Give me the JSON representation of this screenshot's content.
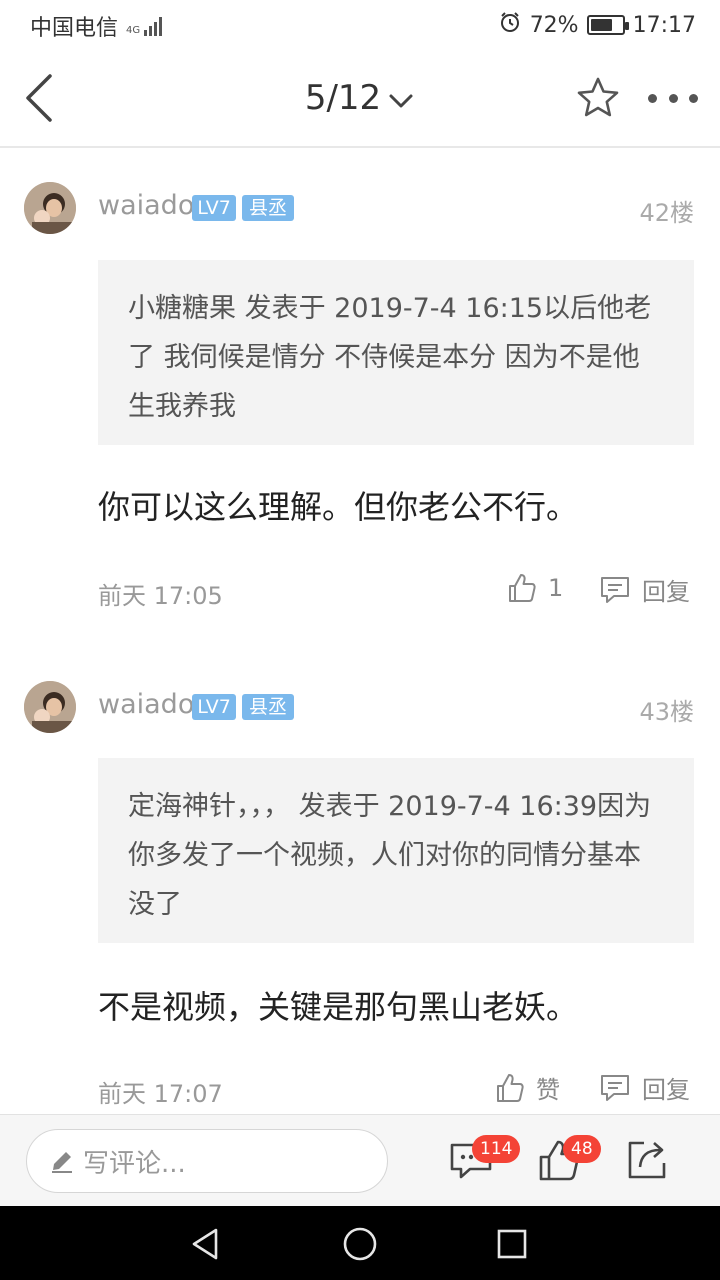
{
  "status_bar": {
    "carrier": "中国电信",
    "network": "4G",
    "battery_percent": "72%",
    "battery_level": 0.72,
    "time": "17:17",
    "alarm_icon": "alarm-icon"
  },
  "nav": {
    "page_indicator": "5/12",
    "back_icon": "back-icon",
    "dropdown_icon": "chevron-down-icon",
    "favorite_icon": "star-icon",
    "more_icon": "more-icon"
  },
  "posts": [
    {
      "username": "waiado",
      "level": "LV7",
      "title": "县丞",
      "floor": "42楼",
      "quote": "小糖糖果 发表于 2019-7-4 16:15以后他老了 我伺候是情分 不侍候是本分 因为不是他生我养我",
      "content": "你可以这么理解。但你老公不行。",
      "time": "前天 17:05",
      "like_label": "1",
      "reply_label": "回复"
    },
    {
      "username": "waiado",
      "level": "LV7",
      "title": "县丞",
      "floor": "43楼",
      "quote": "定海神针，，， 发表于 2019-7-4 16:39因为你多发了一个视频，人们对你的同情分基本没了",
      "content": "不是视频，关键是那句黑山老妖。",
      "time": "前天 17:07",
      "like_label": "赞",
      "reply_label": "回复"
    }
  ],
  "bottom_bar": {
    "comment_placeholder": "写评论...",
    "comment_count": "114",
    "like_count": "48"
  },
  "colors": {
    "badge_blue": "#7ab8ec",
    "count_red": "#f44336",
    "quote_bg": "#f3f3f3"
  }
}
